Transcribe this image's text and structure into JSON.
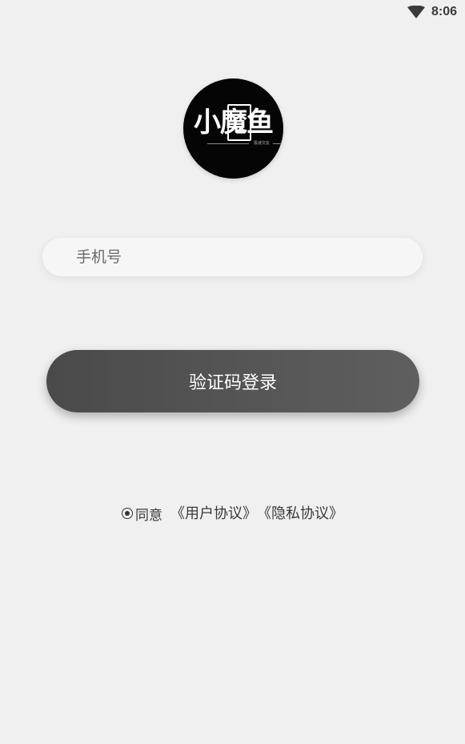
{
  "status_bar": {
    "time": "8:06",
    "icons": [
      "wifi-icon"
    ]
  },
  "logo": {
    "text": "小魔鱼",
    "subtext": "极速交友"
  },
  "phone_field": {
    "placeholder": "手机号",
    "value": ""
  },
  "login_button": {
    "label": "验证码登录"
  },
  "agreement": {
    "prefix": "同意",
    "user_agreement": "《用户协议》",
    "privacy_policy": "《隐私协议》",
    "checked": true
  },
  "colors": {
    "background": "#f0f0f0",
    "button": "#555555",
    "logo_bg": "#050505"
  }
}
